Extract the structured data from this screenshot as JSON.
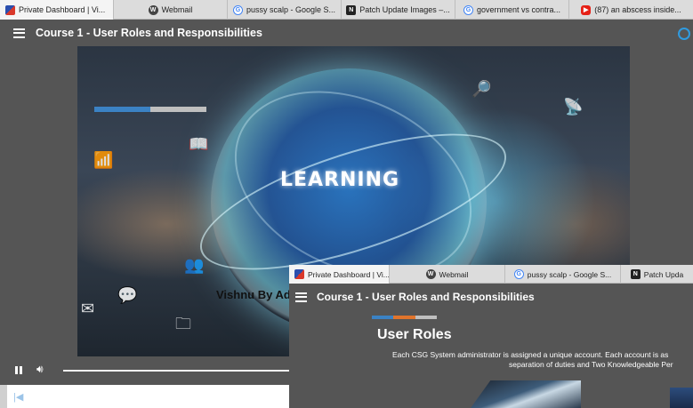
{
  "browser_tabs": [
    {
      "label": "Private Dashboard | Vi...",
      "icon": "dashboard-favicon",
      "active": true
    },
    {
      "label": "Webmail",
      "icon": "webmail-favicon"
    },
    {
      "label": "pussy scalp - Google S...",
      "icon": "google-favicon"
    },
    {
      "label": "Patch Update Images –...",
      "icon": "n-favicon"
    },
    {
      "label": "government vs contra...",
      "icon": "google-favicon"
    },
    {
      "label": "(87) an abscess inside...",
      "icon": "youtube-favicon"
    }
  ],
  "header": {
    "title": "Course 1 - User Roles and Responsibilities"
  },
  "video": {
    "overlay_text": "LEARNING",
    "speaker_text": "Vishnu By Ad",
    "progress_fraction": 0.5
  },
  "second_window": {
    "tabs": [
      {
        "label": "Private Dashboard | Vi...",
        "icon": "dashboard-favicon"
      },
      {
        "label": "Webmail",
        "icon": "webmail-favicon"
      },
      {
        "label": "pussy scalp - Google S...",
        "icon": "google-favicon"
      },
      {
        "label": "Patch Upda",
        "icon": "n-favicon"
      }
    ],
    "header": {
      "title": "Course 1 - User Roles and Responsibilities"
    },
    "section_title": "User Roles",
    "description_line1": "Each CSG System administrator is assigned a unique account. Each account is as",
    "description_line2": "separation of duties and Two Knowledgeable Per",
    "tri_colors": [
      "#3b82c4",
      "#e0742c",
      "#bfbfbf"
    ]
  },
  "colors": {
    "accent": "#3b82c4",
    "background": "#555555",
    "spinner": "#2f9be0"
  }
}
